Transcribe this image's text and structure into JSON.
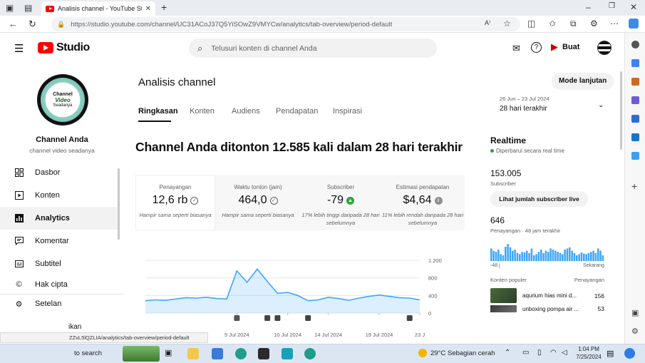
{
  "browser": {
    "tab_title": "Analisis channel - YouTube Studi",
    "url": "https://studio.youtube.com/channel/UC31ACoJ37Q5YiSOwZ9VMYCw/analytics/tab-overview/period-default",
    "status_url": "ZZvL5lQZLIA/analytics/tab-overview/period-default"
  },
  "header": {
    "logo_text": "Studio",
    "search_placeholder": "Telusuri konten di channel Anda",
    "create_label": "Buat"
  },
  "sidebar": {
    "channel_name": "Channel Anda",
    "channel_handle": "channel video seadanya",
    "avatar_text": [
      "Channel",
      "Video",
      "Seadanya"
    ],
    "items": [
      {
        "label": "Dasbor",
        "icon": "dashboard-icon"
      },
      {
        "label": "Konten",
        "icon": "content-icon"
      },
      {
        "label": "Analytics",
        "icon": "analytics-icon"
      },
      {
        "label": "Komentar",
        "icon": "comment-icon"
      },
      {
        "label": "Subtitel",
        "icon": "subtitle-icon"
      },
      {
        "label": "Hak cipta",
        "icon": "copyright-icon"
      },
      {
        "label": "Setelan",
        "icon": "gear-icon"
      }
    ],
    "partial_text": "ikan"
  },
  "main": {
    "page_title": "Analisis channel",
    "advanced_button": "Mode lanjutan",
    "tabs": [
      "Ringkasan",
      "Konten",
      "Audiens",
      "Pendapatan",
      "Inspirasi"
    ],
    "date_range": "26 Jun – 23 Jul 2024",
    "period": "28 hari terakhir",
    "headline": "Channel Anda ditonton 12.585 kali dalam 28 hari terakhir",
    "metrics": [
      {
        "label": "Penayangan",
        "value": "12,6 rb",
        "note": "Hampir sama seperti biasanya",
        "indicator": "check-icon"
      },
      {
        "label": "Waktu tonton (jam)",
        "value": "464,0",
        "note": "Hampir sama seperti biasanya",
        "indicator": "check-icon"
      },
      {
        "label": "Subscriber",
        "value": "-79",
        "note": "17% lebih tinggi daripada 28 hari sebelumnya",
        "indicator": "arrow-up-icon"
      },
      {
        "label": "Estimasi pendapatan",
        "value": "$4,64",
        "note": "11% lebih rendah daripada 28 hari sebelumnya",
        "indicator": "info-icon"
      }
    ]
  },
  "chart_data": {
    "type": "area",
    "x": [
      "26 Jun",
      "27 Jun",
      "28 Jun",
      "29 Jun",
      "30 Jun",
      "1 Jul",
      "2 Jul",
      "3 Jul",
      "4 Jul",
      "5 Jul",
      "6 Jul",
      "7 Jul",
      "8 Jul",
      "9 Jul",
      "10 Jul",
      "11 Jul",
      "12 Jul",
      "13 Jul",
      "14 Jul",
      "15 Jul",
      "16 Jul",
      "17 Jul",
      "18 Jul",
      "19 Jul",
      "20 Jul",
      "21 Jul",
      "22 Jul",
      "23 Jul"
    ],
    "values": [
      280,
      300,
      290,
      320,
      350,
      340,
      360,
      330,
      320,
      960,
      700,
      1000,
      720,
      450,
      470,
      400,
      280,
      300,
      360,
      330,
      290,
      340,
      380,
      410,
      380,
      350,
      340,
      300
    ],
    "y_ticks": [
      "1.200",
      "800",
      "400",
      "0"
    ],
    "ylim": [
      0,
      1200
    ],
    "x_tick_labels": [
      "5 Jul 2024",
      "10 Jul 2024",
      "14 Jul 2024",
      "19 Jul 2024",
      "23 J"
    ],
    "grid": true,
    "color": "#3ea6ff"
  },
  "realtime": {
    "title": "Realtime",
    "status": "Diperbarui secara real time",
    "subscribers": "153.005",
    "subscribers_label": "Subscriber",
    "live_button": "Lihat jumlah subscriber live",
    "views": "646",
    "views_label": "Penayangan · 48 jam terakhir",
    "bars_48h": [
      22,
      18,
      16,
      20,
      12,
      10,
      25,
      30,
      24,
      18,
      20,
      14,
      12,
      16,
      15,
      18,
      14,
      22,
      10,
      12,
      16,
      20,
      14,
      18,
      16,
      22,
      20,
      18,
      16,
      14,
      12,
      20,
      22,
      24,
      18,
      14,
      10,
      12,
      15,
      13,
      12,
      14,
      16,
      18,
      14,
      22,
      18,
      10
    ],
    "axis_left": "-48 j",
    "axis_right": "Sekarang",
    "popular_header": "Konten populer",
    "popular_views_header": "Penayangan",
    "popular": [
      {
        "title": "aqurium hias mini d...",
        "views": "156"
      },
      {
        "title": "unboxing pompa air ...",
        "views": "53"
      }
    ]
  },
  "taskbar": {
    "search": "to search",
    "weather_temp": "29°C",
    "weather_text": "Sebagian cerah",
    "time": "1:04 PM",
    "date": "7/25/2024"
  },
  "colors": {
    "accent": "#ff0000",
    "chart": "#3ea6ff",
    "realtime_dot": "#2ba640"
  }
}
